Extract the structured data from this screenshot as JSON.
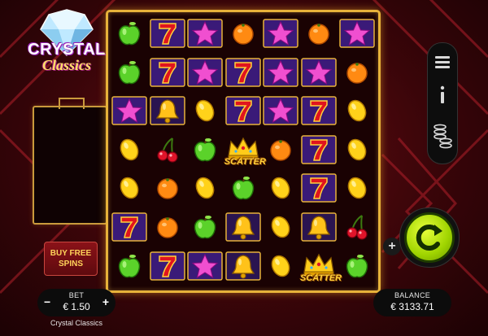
{
  "logo": {
    "title": "CRYSTAL",
    "subtitle": "Classics"
  },
  "buy_free_spins": {
    "line1": "BUY FREE",
    "line2": "SPINS"
  },
  "bet": {
    "label": "BET",
    "value": "€ 1.50",
    "minus": "−",
    "plus": "+"
  },
  "game_name": "Crystal Classics",
  "balance": {
    "label": "BALANCE",
    "value": "€ 3133.71"
  },
  "scatter_label": "SCATTER",
  "reels": [
    [
      "apple",
      "seven",
      "star",
      "orange",
      "star",
      "orange",
      "star"
    ],
    [
      "apple",
      "seven",
      "star",
      "seven",
      "star",
      "star",
      "orange"
    ],
    [
      "star",
      "bell",
      "lemon",
      "seven",
      "star",
      "seven",
      "lemon"
    ],
    [
      "lemon",
      "cherry",
      "apple",
      "scatter",
      "orange",
      "seven",
      "lemon"
    ],
    [
      "lemon",
      "orange",
      "lemon",
      "apple",
      "lemon",
      "seven",
      "lemon"
    ],
    [
      "seven",
      "orange",
      "apple",
      "bell",
      "lemon",
      "bell",
      "cherry"
    ],
    [
      "apple",
      "seven",
      "star",
      "bell",
      "lemon",
      "scatter",
      "apple"
    ]
  ],
  "colors": {
    "frame_gold": "#e7b23a",
    "spin_green": "#9fd400",
    "bg_red": "#6a0d14"
  },
  "menu_icons": [
    "hamburger-menu-icon",
    "info-icon",
    "coin-stack-icon"
  ],
  "spin_icon": "spin-arrow-icon"
}
